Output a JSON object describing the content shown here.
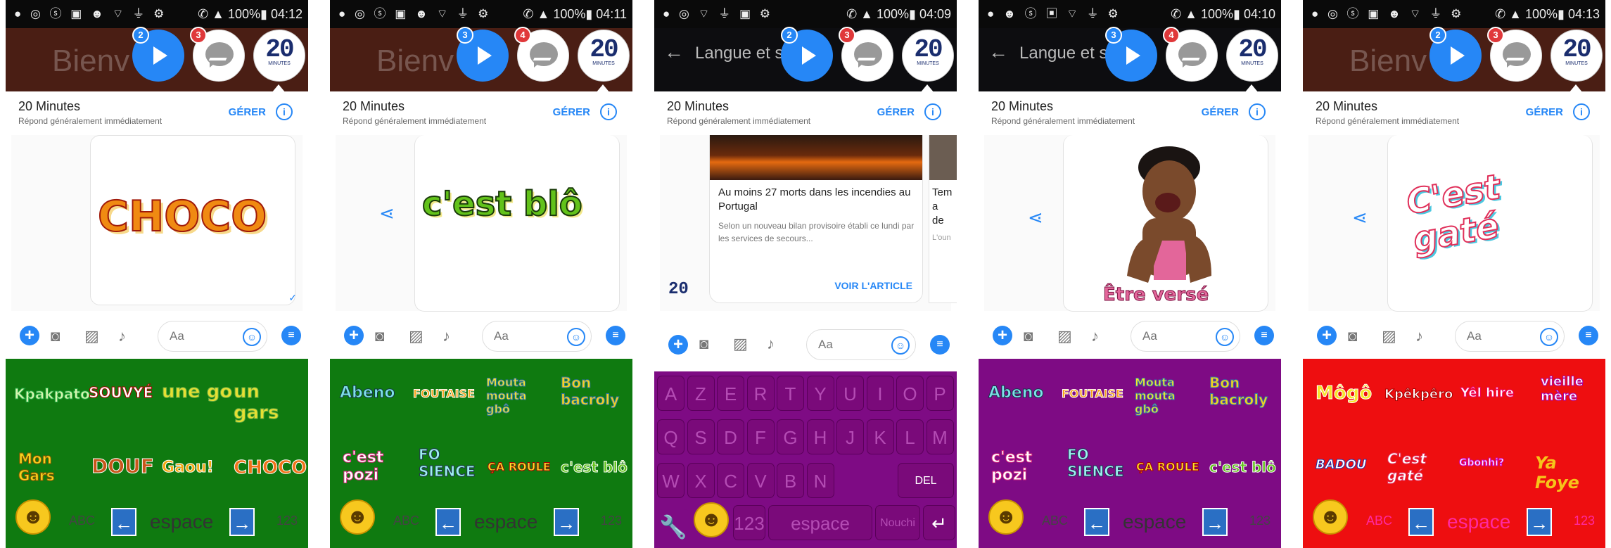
{
  "screens": [
    {
      "time": "04:12",
      "battery": "100%",
      "appbar": "Bienv",
      "badges": [
        "2",
        "3"
      ]
    },
    {
      "time": "04:11",
      "battery": "100%",
      "appbar": "Bienv",
      "badges": [
        "3",
        "4"
      ]
    },
    {
      "time": "04:09",
      "battery": "100%",
      "appbar": "Langue et s",
      "badges": [
        "2",
        "3"
      ]
    },
    {
      "time": "04:10",
      "battery": "100%",
      "appbar": "Langue et s",
      "badges": [
        "3",
        "4"
      ]
    },
    {
      "time": "04:13",
      "battery": "100%",
      "appbar": "Bienv",
      "badges": [
        "2",
        "3"
      ]
    }
  ],
  "chathead": {
    "logo_big": "20",
    "logo_small": "MINUTES"
  },
  "header": {
    "name": "20 Minutes",
    "subtitle": "Répond généralement immédiatement",
    "manage": "GÉRER",
    "info": "i"
  },
  "composer": {
    "placeholder": "Aa"
  },
  "stickers_sent": [
    "CHOCO",
    "c'est blô",
    "Être versé",
    "C'est gaté"
  ],
  "article": {
    "title": "Au moins 27 morts dans les incendies au Portugal",
    "body": "Selon un nouveau bilan provisoire établi ce lundi par les services de secours...",
    "cta": "VOIR L'ARTICLE",
    "logo": "20",
    "side_title": "Tem a de",
    "side_body": "L'oun"
  },
  "keyboard": {
    "abc": "ABC",
    "space": "espace",
    "num": "123",
    "nouchi": "Nouchi",
    "del": "DEL",
    "sets": [
      [
        "Kpakpato",
        "SOUVYÉ",
        "une go",
        "un gars",
        "Mon Gars",
        "DOUF",
        "Gaou!",
        "CHOCO"
      ],
      [
        "Abeno",
        "FOUTAISE",
        "Mouta mouta gbô",
        "Bon bacroly",
        "c'est pozi",
        "FO SIENCE",
        "ÇA ROULE",
        "c'est blô"
      ],
      [],
      [
        "Abeno",
        "FOUTAISE",
        "Mouta mouta gbô",
        "Bon bacroly",
        "c'est pozi",
        "FO SIENCE",
        "ÇA ROULE",
        "c'est blô"
      ],
      [
        "Môgô",
        "Kpêkpêro",
        "Yêl hire",
        "vieille mère",
        "BADOU",
        "C'est gaté",
        "Gbonhi?",
        "Ya Foye"
      ]
    ],
    "azerty": [
      [
        "A",
        "Z",
        "E",
        "R",
        "T",
        "Y",
        "U",
        "I",
        "O",
        "P"
      ],
      [
        "Q",
        "S",
        "D",
        "F",
        "G",
        "H",
        "J",
        "K",
        "L",
        "M"
      ],
      [
        "W",
        "X",
        "C",
        "V",
        "B",
        "N"
      ]
    ]
  },
  "colors": {
    "green": "#0f7a10",
    "purple": "#7e0b84",
    "red": "#ee0e10",
    "messenger_blue": "#2687f6",
    "brown": "#4a1e14"
  }
}
